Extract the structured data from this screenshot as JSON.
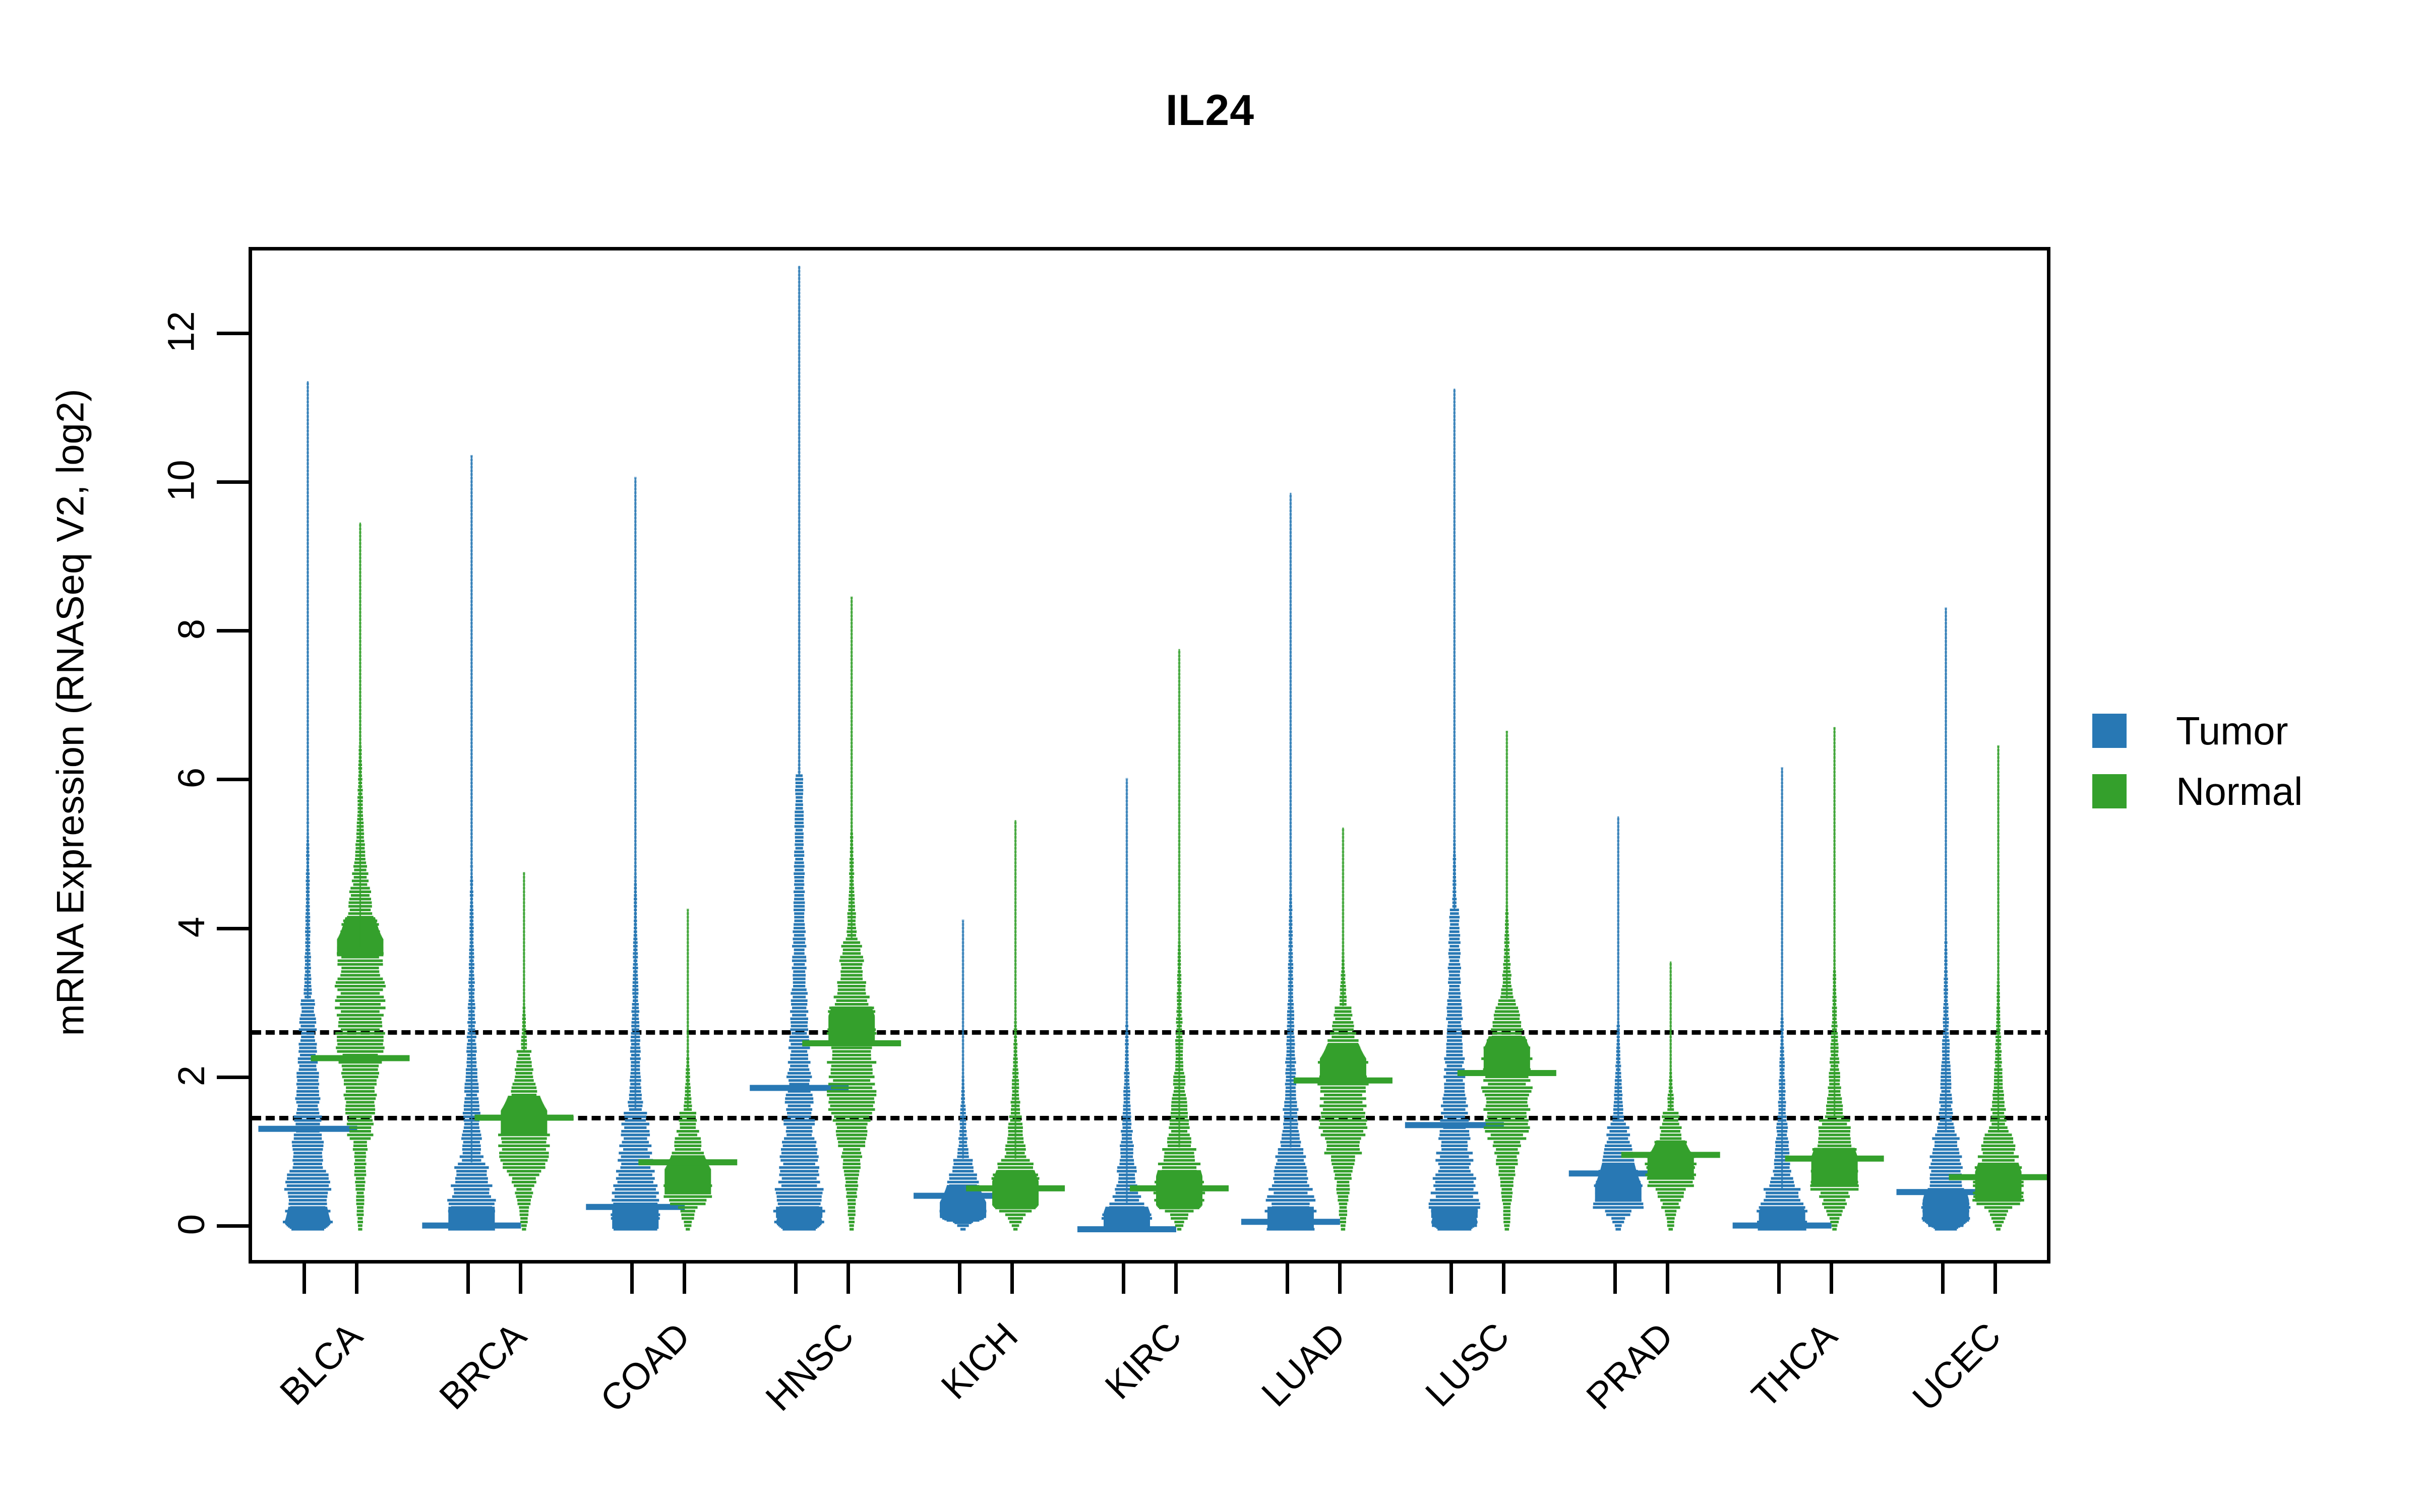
{
  "chart_data": {
    "type": "violin",
    "title": "IL24",
    "xlabel": "",
    "ylabel": "mRNA Expression (RNASeq V2, log2)",
    "ylim": [
      -0.55,
      13.2
    ],
    "y_ticks": [
      0,
      2,
      4,
      6,
      8,
      10,
      12
    ],
    "y_tick_labels": [
      "0",
      "2",
      "4",
      "6",
      "8",
      "10",
      "12"
    ],
    "grid": false,
    "legend_position": "right",
    "reference_lines": [
      2.65,
      1.5
    ],
    "categories": [
      "BLCA",
      "BRCA",
      "COAD",
      "HNSC",
      "KICH",
      "KIRC",
      "LUAD",
      "LUSC",
      "PRAD",
      "THCA",
      "UCEC"
    ],
    "series": [
      {
        "name": "Tumor",
        "color": "#2878b4",
        "distributions": [
          {
            "category": "BLCA",
            "min": 0.0,
            "q1": 0.35,
            "median": 1.35,
            "q3": 3.1,
            "max": 11.4,
            "mode": 0.0,
            "peak_y": 0.1
          },
          {
            "category": "BRCA",
            "min": 0.0,
            "q1": 0.0,
            "median": 0.05,
            "q3": 0.9,
            "max": 10.4,
            "mode": 0.0,
            "peak_y": 0.05
          },
          {
            "category": "COAD",
            "min": 0.0,
            "q1": 0.0,
            "median": 0.3,
            "q3": 1.6,
            "max": 10.1,
            "mode": 0.0,
            "peak_y": 0.1
          },
          {
            "category": "HNSC",
            "min": 0.0,
            "q1": 0.15,
            "median": 1.9,
            "q3": 6.1,
            "max": 12.95,
            "mode": 0.0,
            "peak_y": 0.1
          },
          {
            "category": "KICH",
            "min": 0.0,
            "q1": 0.1,
            "median": 0.45,
            "q3": 0.95,
            "max": 4.15,
            "mode": 0.3,
            "peak_y": 0.25
          },
          {
            "category": "KIRC",
            "min": 0.0,
            "q1": 0.0,
            "median": 0.0,
            "q3": 0.35,
            "max": 6.05,
            "mode": 0.0,
            "peak_y": 0.05
          },
          {
            "category": "LUAD",
            "min": 0.0,
            "q1": 0.0,
            "median": 0.1,
            "q3": 1.1,
            "max": 9.9,
            "mode": 0.0,
            "peak_y": 0.05
          },
          {
            "category": "LUSC",
            "min": 0.0,
            "q1": 0.15,
            "median": 1.4,
            "q3": 4.3,
            "max": 11.3,
            "mode": 0.0,
            "peak_y": 0.1
          },
          {
            "category": "PRAD",
            "min": 0.0,
            "q1": 0.25,
            "median": 0.75,
            "q3": 1.45,
            "max": 5.55,
            "mode": 0.6,
            "peak_y": 0.45
          },
          {
            "category": "THCA",
            "min": 0.0,
            "q1": 0.0,
            "median": 0.05,
            "q3": 0.55,
            "max": 6.2,
            "mode": 0.0,
            "peak_y": 0.05
          },
          {
            "category": "UCEC",
            "min": 0.0,
            "q1": 0.1,
            "median": 0.5,
            "q3": 1.3,
            "max": 8.35,
            "mode": 0.2,
            "peak_y": 0.15
          }
        ]
      },
      {
        "name": "Normal",
        "color": "#34a02c",
        "distributions": [
          {
            "category": "BLCA",
            "min": 0.0,
            "q1": 1.2,
            "median": 2.3,
            "q3": 3.8,
            "max": 9.5,
            "mode": 3.9,
            "peak_y": 3.9
          },
          {
            "category": "BRCA",
            "min": 0.0,
            "q1": 0.7,
            "median": 1.5,
            "q3": 2.4,
            "max": 4.8,
            "mode": 1.5,
            "peak_y": 1.5
          },
          {
            "category": "COAD",
            "min": 0.0,
            "q1": 0.3,
            "median": 0.9,
            "q3": 1.6,
            "max": 4.3,
            "mode": 0.7,
            "peak_y": 0.7
          },
          {
            "category": "HNSC",
            "min": 0.0,
            "q1": 1.1,
            "median": 2.5,
            "q3": 3.9,
            "max": 8.5,
            "mode": 2.7,
            "peak_y": 2.7
          },
          {
            "category": "KICH",
            "min": 0.0,
            "q1": 0.2,
            "median": 0.55,
            "q3": 0.95,
            "max": 5.5,
            "mode": 0.5,
            "peak_y": 0.5
          },
          {
            "category": "KIRC",
            "min": 0.0,
            "q1": 0.2,
            "median": 0.55,
            "q3": 1.1,
            "max": 7.8,
            "mode": 0.5,
            "peak_y": 0.5
          },
          {
            "category": "LUAD",
            "min": 0.0,
            "q1": 1.0,
            "median": 2.0,
            "q3": 3.0,
            "max": 5.4,
            "mode": 2.2,
            "peak_y": 2.2
          },
          {
            "category": "LUSC",
            "min": 0.0,
            "q1": 1.2,
            "median": 2.1,
            "q3": 3.1,
            "max": 6.7,
            "mode": 2.3,
            "peak_y": 2.3
          },
          {
            "category": "PRAD",
            "min": 0.0,
            "q1": 0.55,
            "median": 1.0,
            "q3": 1.6,
            "max": 3.6,
            "mode": 0.9,
            "peak_y": 0.9
          },
          {
            "category": "THCA",
            "min": 0.0,
            "q1": 0.5,
            "median": 0.95,
            "q3": 1.5,
            "max": 6.75,
            "mode": 0.8,
            "peak_y": 0.8
          },
          {
            "category": "UCEC",
            "min": 0.0,
            "q1": 0.3,
            "median": 0.7,
            "q3": 1.3,
            "max": 6.5,
            "mode": 0.6,
            "peak_y": 0.6
          }
        ]
      }
    ]
  },
  "chart": {
    "title": "IL24",
    "y_axis_title": "mRNA Expression (RNASeq V2, log2)",
    "y_tick_labels": [
      "0",
      "2",
      "4",
      "6",
      "8",
      "10",
      "12"
    ],
    "x_tick_labels": [
      "BLCA",
      "BRCA",
      "COAD",
      "HNSC",
      "KICH",
      "KIRC",
      "LUAD",
      "LUSC",
      "PRAD",
      "THCA",
      "UCEC"
    ]
  },
  "legend": {
    "items": [
      {
        "label": "Tumor",
        "color": "#2878b4"
      },
      {
        "label": "Normal",
        "color": "#34a02c"
      }
    ]
  },
  "colors": {
    "tumor": "#2878b4",
    "normal": "#34a02c",
    "axis": "#000000",
    "background": "#ffffff"
  }
}
